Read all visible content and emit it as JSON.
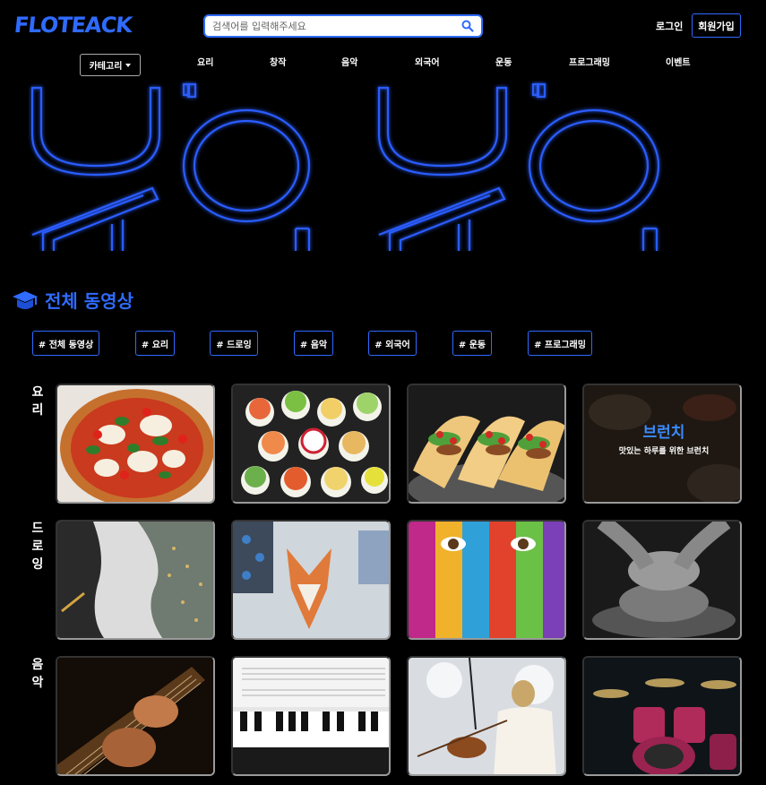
{
  "header": {
    "logo": "FLOTEACK",
    "search_placeholder": "검색어를 입력해주세요",
    "login": "로그인",
    "signup": "회원가입"
  },
  "nav": {
    "category_button": "카테고리",
    "items": [
      "요리",
      "창작",
      "음악",
      "외국어",
      "운동",
      "프로그래밍",
      "이벤트"
    ]
  },
  "section": {
    "title": "전체 동영상",
    "tags": [
      "# 전체 동영상",
      "# 요리",
      "# 드로잉",
      "# 음악",
      "# 외국어",
      "# 운동",
      "# 프로그래밍"
    ]
  },
  "rows": [
    {
      "label": "요리",
      "cards": [
        {
          "name": "pizza-thumbnail"
        },
        {
          "name": "sushi-thumbnail"
        },
        {
          "name": "tacos-thumbnail"
        },
        {
          "name": "brunch-thumbnail",
          "title": "브런치",
          "subtitle": "맛있는 하루를 위한 브런치"
        }
      ]
    },
    {
      "label": "드로잉",
      "cards": [
        {
          "name": "ink-art-thumbnail"
        },
        {
          "name": "fox-watercolor-thumbnail"
        },
        {
          "name": "face-paint-thumbnail"
        },
        {
          "name": "pottery-thumbnail"
        }
      ]
    },
    {
      "label": "음악",
      "cards": [
        {
          "name": "guitar-thumbnail"
        },
        {
          "name": "piano-thumbnail"
        },
        {
          "name": "violin-thumbnail"
        },
        {
          "name": "drums-thumbnail"
        }
      ]
    }
  ],
  "colors": {
    "accent": "#2f6bff",
    "background": "#000000"
  }
}
